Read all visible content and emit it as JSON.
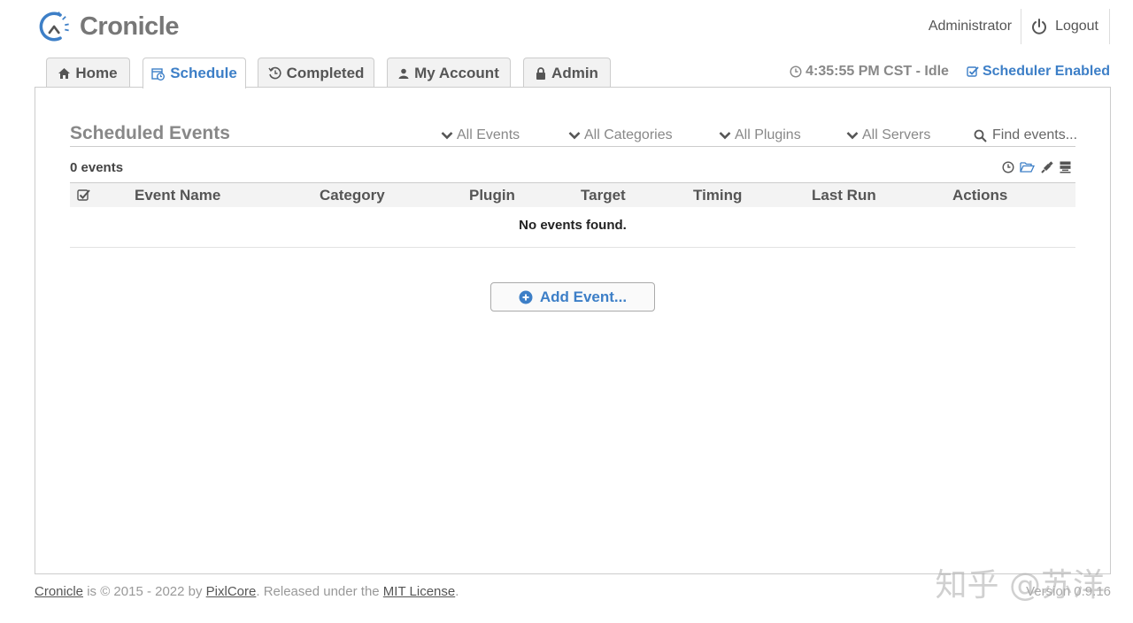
{
  "app": {
    "name": "Cronicle"
  },
  "user": {
    "name": "Administrator",
    "logout_label": "Logout"
  },
  "tabs": [
    {
      "label": "Home",
      "icon": "home-icon",
      "active": false
    },
    {
      "label": "Schedule",
      "icon": "calendar-clock-icon",
      "active": true
    },
    {
      "label": "Completed",
      "icon": "history-icon",
      "active": false
    },
    {
      "label": "My Account",
      "icon": "user-icon",
      "active": false
    },
    {
      "label": "Admin",
      "icon": "lock-icon",
      "active": false
    }
  ],
  "status": {
    "clock": "4:35:55 PM CST - Idle",
    "scheduler": "Scheduler Enabled"
  },
  "main": {
    "title": "Scheduled Events",
    "filters": [
      "All Events",
      "All Categories",
      "All Plugins",
      "All Servers"
    ],
    "search_placeholder": "Find events...",
    "count": "0 events",
    "columns": [
      "Event Name",
      "Category",
      "Plugin",
      "Target",
      "Timing",
      "Last Run",
      "Actions"
    ],
    "empty_message": "No events found.",
    "add_button": "Add Event..."
  },
  "footer": {
    "app_link": "Cronicle",
    "text1": " is © 2015 - 2022 by ",
    "company_link": "PixlCore",
    "text2": ". Released under the ",
    "license_link": "MIT License",
    "text3": ".",
    "version": "Version 0.9.16"
  },
  "watermark": "知乎 @苏洋",
  "colors": {
    "accent": "#3d7fc7",
    "muted": "#888888",
    "border": "#cccccc"
  }
}
